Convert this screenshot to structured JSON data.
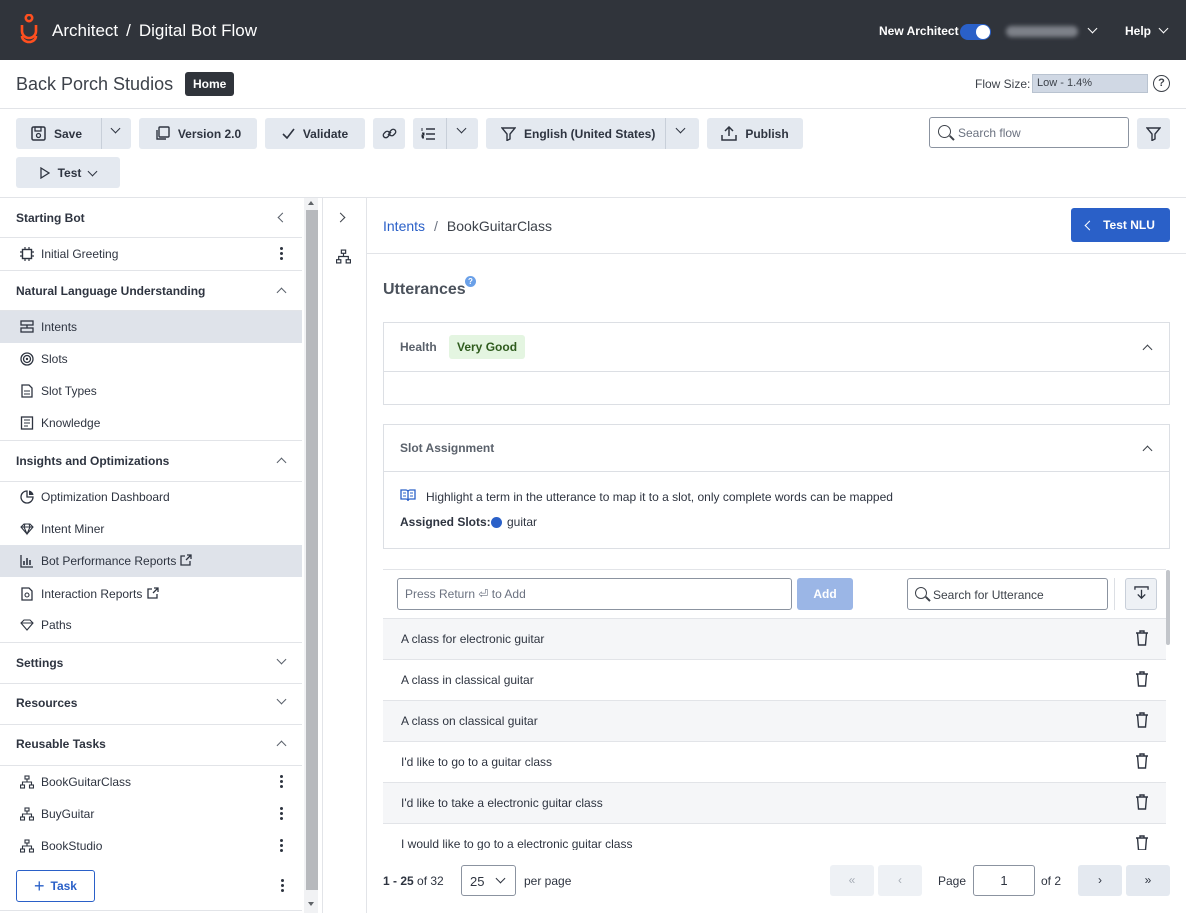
{
  "topbar": {
    "app_name": "Architect",
    "separator": "/",
    "flow_name": "Digital Bot Flow",
    "new_architect_label": "New Architect",
    "help_label": "Help"
  },
  "subheader": {
    "org_name": "Back Porch Studios",
    "home_badge": "Home",
    "flow_size_label": "Flow Size:",
    "flow_size_value": "Low - 1.4%",
    "flow_size_fraction": 0.014
  },
  "toolbar": {
    "save_label": "Save",
    "version_label": "Version 2.0",
    "validate_label": "Validate",
    "language_label": "English (United States)",
    "publish_label": "Publish",
    "test_label": "Test",
    "search_placeholder": "Search flow"
  },
  "sidebar": {
    "sections": [
      {
        "title": "Starting Bot",
        "items": [
          {
            "label": "Initial Greeting",
            "icon": "chip-icon"
          }
        ]
      },
      {
        "title": "Natural Language Understanding",
        "items": [
          {
            "label": "Intents",
            "icon": "intents-icon",
            "active": true
          },
          {
            "label": "Slots",
            "icon": "target-icon"
          },
          {
            "label": "Slot Types",
            "icon": "document-icon"
          },
          {
            "label": "Knowledge",
            "icon": "book-icon"
          }
        ]
      },
      {
        "title": "Insights and Optimizations",
        "items": [
          {
            "label": "Optimization Dashboard",
            "icon": "pie-icon"
          },
          {
            "label": "Intent Miner",
            "icon": "gem-icon"
          },
          {
            "label": "Bot Performance Reports",
            "icon": "bar-chart-icon",
            "active": true
          },
          {
            "label": "Interaction Reports",
            "icon": "document-icon"
          },
          {
            "label": "Paths",
            "icon": "gem-icon"
          }
        ]
      },
      {
        "title": "Settings"
      },
      {
        "title": "Resources"
      },
      {
        "title": "Reusable Tasks",
        "items": [
          {
            "label": "BookGuitarClass",
            "icon": "flow-icon"
          },
          {
            "label": "BuyGuitar",
            "icon": "flow-icon"
          },
          {
            "label": "BookStudio",
            "icon": "flow-icon"
          }
        ]
      }
    ],
    "add_task_label": "Task"
  },
  "main": {
    "breadcrumb_parent": "Intents",
    "breadcrumb_sep": "/",
    "breadcrumb_current": "BookGuitarClass",
    "test_nlu_label": "Test NLU",
    "utterances_title": "Utterances",
    "health_label": "Health",
    "health_value": "Very Good",
    "slot_assignment_title": "Slot Assignment",
    "slot_info": "Highlight a term in the utterance to map it to a slot, only complete words can be mapped",
    "assigned_slots_label": "Assigned Slots:",
    "assigned_slot": "guitar",
    "slot_color": "#2a60c8",
    "utterance_placeholder": "Press Return ⏎ to Add",
    "add_label": "Add",
    "utterance_search_placeholder": "Search for Utterance",
    "utterances": [
      "A class for electronic guitar",
      "A class in classical guitar",
      "A class on classical guitar",
      "I'd like to go to a guitar class",
      "I'd like to take a electronic guitar class",
      "I would like to go to a electronic guitar class"
    ],
    "pager": {
      "range": "1 - 25",
      "of_total": "of 32",
      "per_page_value": "25",
      "per_page_label": "per page",
      "page_label": "Page",
      "page_value": "1",
      "of_pages": "of 2"
    }
  },
  "colors": {
    "accent": "#2a60c8",
    "topbar": "#30343b"
  }
}
